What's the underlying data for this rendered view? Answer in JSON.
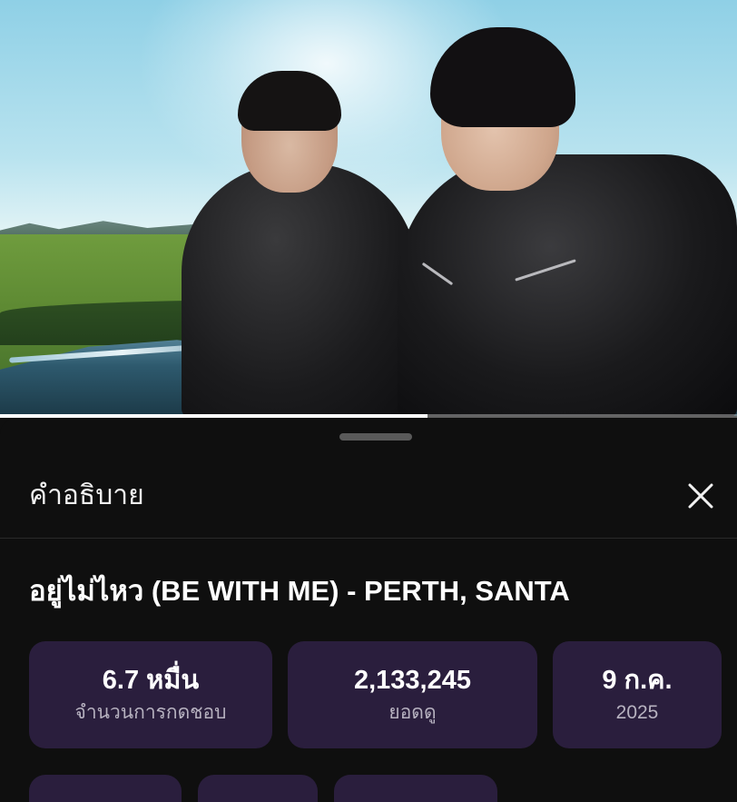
{
  "video": {
    "progress_fraction": 0.58
  },
  "sheet": {
    "title": "คำอธิบาย",
    "close_icon": "close-icon"
  },
  "video_info": {
    "title": "อยู่ไม่ไหว (BE WITH ME) - PERTH, SANTA",
    "stats": [
      {
        "value": "6.7 หมื่น",
        "label": "จำนวนการกดชอบ"
      },
      {
        "value": "2,133,245",
        "label": "ยอดดู"
      },
      {
        "value": "9 ก.ค.",
        "label": "2025"
      }
    ]
  },
  "colors": {
    "background": "#0f0f0f",
    "card": "#2a1e3d",
    "text_primary": "#ffffff",
    "text_secondary": "#b7b2c0"
  }
}
